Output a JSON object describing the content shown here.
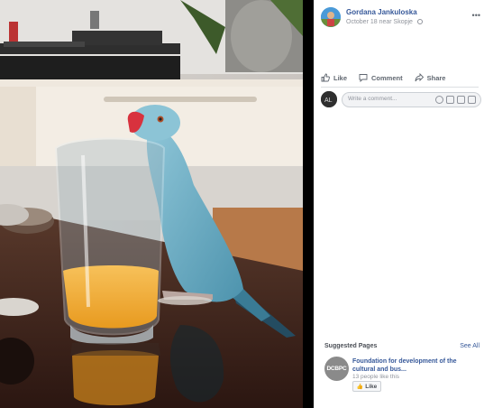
{
  "post": {
    "author_name": "Gordana Jankuloska",
    "meta": "October 18 near Skopje",
    "more_icon": "more-icon",
    "privacy_icon": "globe-icon"
  },
  "actions": {
    "like_label": "Like",
    "comment_label": "Comment",
    "share_label": "Share"
  },
  "comment": {
    "placeholder": "Write a comment..."
  },
  "suggested": {
    "title": "Suggested Pages",
    "see_all": "See All",
    "page": {
      "logo_text": "DCBPC",
      "name": "Foundation for development of the cultural and bus...",
      "likes": "13 people like this",
      "like_button": "Like"
    }
  },
  "colors": {
    "link": "#365899",
    "muted": "#90949c"
  }
}
